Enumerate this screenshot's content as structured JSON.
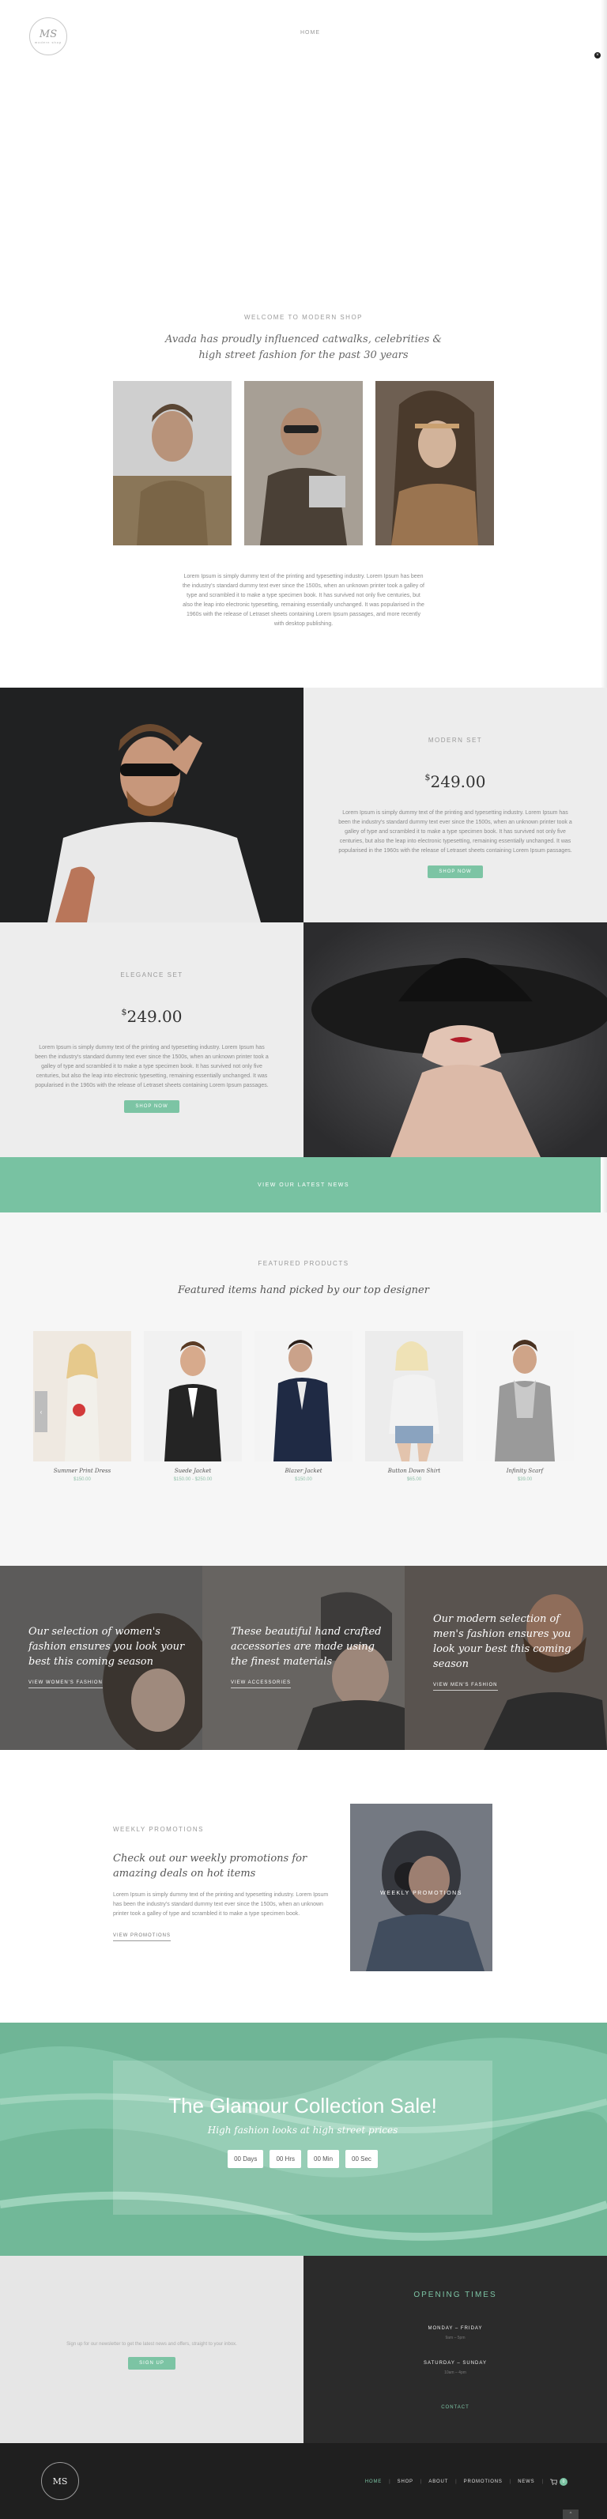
{
  "header": {
    "logo_text": "MS",
    "logo_ring": "modern shop",
    "nav_item": "HOME",
    "close_glyph": "×"
  },
  "welcome": {
    "eyebrow": "WELCOME TO MODERN SHOP",
    "heading": "Avada has proudly influenced catwalks, celebrities & high street fashion for the past 30 years",
    "text": "Lorem Ipsum is simply dummy text of the printing and typesetting industry. Lorem Ipsum has been the industry's standard dummy text ever since the 1500s, when an unknown printer took a galley of type and scrambled it to make a type specimen book. It has survived not only five centuries, but also the leap into electronic typesetting, remaining essentially unchanged. It was popularised in the 1960s with the release of Letraset sheets containing Lorem Ipsum passages, and more recently with desktop publishing."
  },
  "modern_set": {
    "eyebrow": "MODERN SET",
    "price_symbol": "$",
    "price": "249.00",
    "text": "Lorem Ipsum is simply dummy text of the printing and typesetting industry. Lorem Ipsum has been the industry's standard dummy text ever since the 1500s, when an unknown printer took a galley of type and scrambled it to make a type specimen book. It has survived not only five centuries, but also the leap into electronic typesetting, remaining essentially unchanged. It was popularised in the 1960s with the release of Letraset sheets containing Lorem Ipsum passages.",
    "button": "SHOP NOW"
  },
  "elegance_set": {
    "eyebrow": "ELEGANCE SET",
    "price_symbol": "$",
    "price": "249.00",
    "text": "Lorem Ipsum is simply dummy text of the printing and typesetting industry. Lorem Ipsum has been the industry's standard dummy text ever since the 1500s, when an unknown printer took a galley of type and scrambled it to make a type specimen book. It has survived not only five centuries, but also the leap into electronic typesetting, remaining essentially unchanged. It was popularised in the 1960s with the release of Letraset sheets containing Lorem Ipsum passages.",
    "button": "SHOP NOW"
  },
  "news_banner": {
    "label": "VIEW OUR LATEST NEWS"
  },
  "featured": {
    "eyebrow": "FEATURED PRODUCTS",
    "heading": "Featured items hand picked by our top designer",
    "prev_glyph": "‹",
    "products": [
      {
        "name": "Summer Print Dress",
        "price": "$150.00"
      },
      {
        "name": "Suede Jacket",
        "price": "$150.00 - $250.00"
      },
      {
        "name": "Blazer Jacket",
        "price": "$150.00"
      },
      {
        "name": "Button Down Shirt",
        "price": "$65.00"
      },
      {
        "name": "Infinity Scarf",
        "price": "$39.00"
      }
    ]
  },
  "categories": [
    {
      "heading": "Our selection of women's fashion ensures you look your best this coming season",
      "link": "VIEW WOMEN'S FASHION"
    },
    {
      "heading": "These beautiful hand crafted accessories are made using the finest materials",
      "link": "VIEW ACCESSORIES"
    },
    {
      "heading": "Our modern selection of men's fashion ensures you look your best this coming season",
      "link": "VIEW MEN'S FASHION"
    }
  ],
  "promotions": {
    "eyebrow": "WEEKLY PROMOTIONS",
    "heading": "Check out our weekly promotions for amazing deals on hot items",
    "text": "Lorem Ipsum is simply dummy text of the printing and typesetting industry. Lorem Ipsum has been the industry's standard dummy text ever since the 1500s, when an unknown printer took a galley of type and scrambled it to make a type specimen book.",
    "link": "VIEW PROMOTIONS",
    "photo_label": "WEEKLY PROMOTIONS"
  },
  "sale": {
    "title": "The Glamour Collection Sale!",
    "subtitle": "High fashion looks at high street prices",
    "countdown": [
      "00 Days",
      "00 Hrs",
      "00 Min",
      "00 Sec"
    ]
  },
  "newsletter": {
    "text": "Sign up for our newsletter to get the latest news and offers, straight to your inbox.",
    "button": "SIGN UP"
  },
  "opening_times": {
    "title": "OPENING TIMES",
    "weekday_label": "MONDAY – FRIDAY",
    "weekday_hours": "9am – 5pm",
    "weekend_label": "SATURDAY – SUNDAY",
    "weekend_hours": "10am – 4pm",
    "contact": "CONTACT"
  },
  "footer": {
    "logo_text": "MS",
    "nav": [
      "HOME",
      "SHOP",
      "ABOUT",
      "PROMOTIONS",
      "NEWS"
    ],
    "cart_count": "0",
    "to_top_glyph": "^"
  },
  "colors": {
    "accent": "#7cc4a4",
    "dark": "#2b2b2b",
    "light_panel": "#ededed"
  }
}
